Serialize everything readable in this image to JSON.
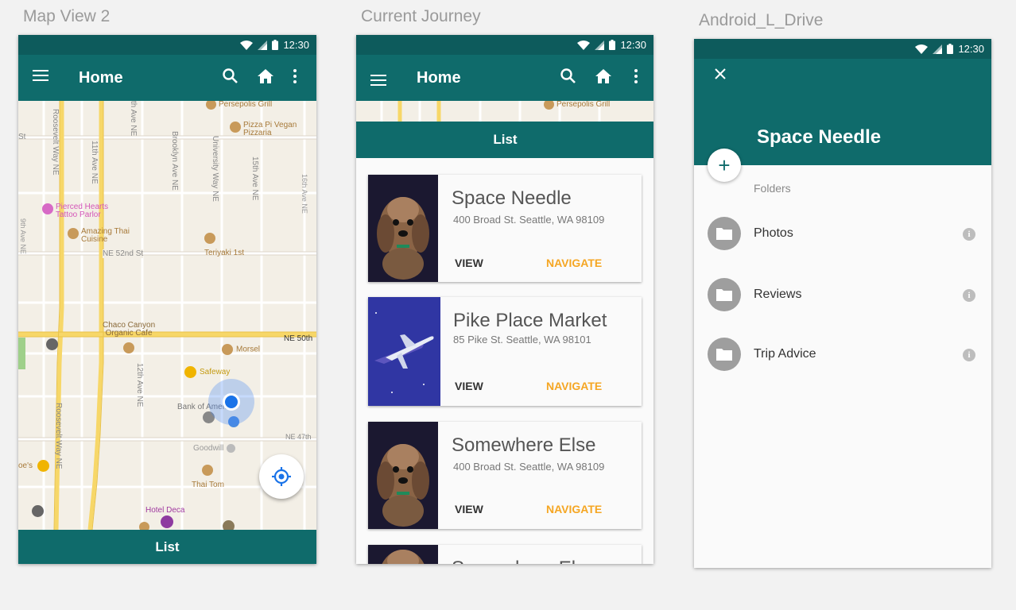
{
  "artboards": {
    "map_title": "Map View 2",
    "list_title": "Current Journey",
    "drive_title": "Android_L_Drive"
  },
  "status": {
    "time": "12:30"
  },
  "appbar": {
    "title": "Home"
  },
  "map": {
    "labels": {
      "persepolis": "Persepolis Grill",
      "pizza1": "Pizza Pi Vegan",
      "pizza2": "Pizzaria",
      "pierced1": "Pierced Hearts",
      "pierced2": "Tattoo Parlor",
      "amazing1": "Amazing Thai",
      "amazing2": "Cuisine",
      "teriyaki": "Teriyaki 1st",
      "ne52": "NE 52nd St",
      "chaco1": "Chaco Canyon",
      "chaco2": "Organic Cafe",
      "morsel": "Morsel",
      "ne50": "NE 50th",
      "safeway": "Safeway",
      "bank": "Bank of America",
      "ne47": "NE 47th",
      "goodwill": "Goodwill",
      "joes": "oe's",
      "thaitom": "Thai Tom",
      "hoteldeca": "Hotel Deca",
      "st": "St",
      "roosevelt": "Roosevelt Way NE",
      "eleventh": "11th Ave NE",
      "brooklyn": "Brooklyn Ave NE",
      "university": "University Way NE",
      "fifteenth": "15th Ave NE",
      "sixteenth": "16th Ave NE",
      "ninth": "9th Ave NE",
      "twelfth": "12th Ave NE",
      "tenth": "th Ave NE"
    }
  },
  "list": {
    "header": "List",
    "view_label": "VIEW",
    "navigate_label": "NAVIGATE",
    "cards": [
      {
        "title": "Space Needle",
        "address": "400 Broad St. Seattle, WA 98109"
      },
      {
        "title": "Pike Place Market",
        "address": "85 Pike St. Seattle, WA 98101"
      },
      {
        "title": "Somewhere Else",
        "address": "400 Broad St. Seattle, WA 98109"
      },
      {
        "title": "Somewhere Else"
      }
    ]
  },
  "bottom": {
    "list_label": "List"
  },
  "drive": {
    "title": "Space Needle",
    "folders_label": "Folders",
    "items": [
      "Photos",
      "Reviews",
      "Trip Advice"
    ]
  }
}
